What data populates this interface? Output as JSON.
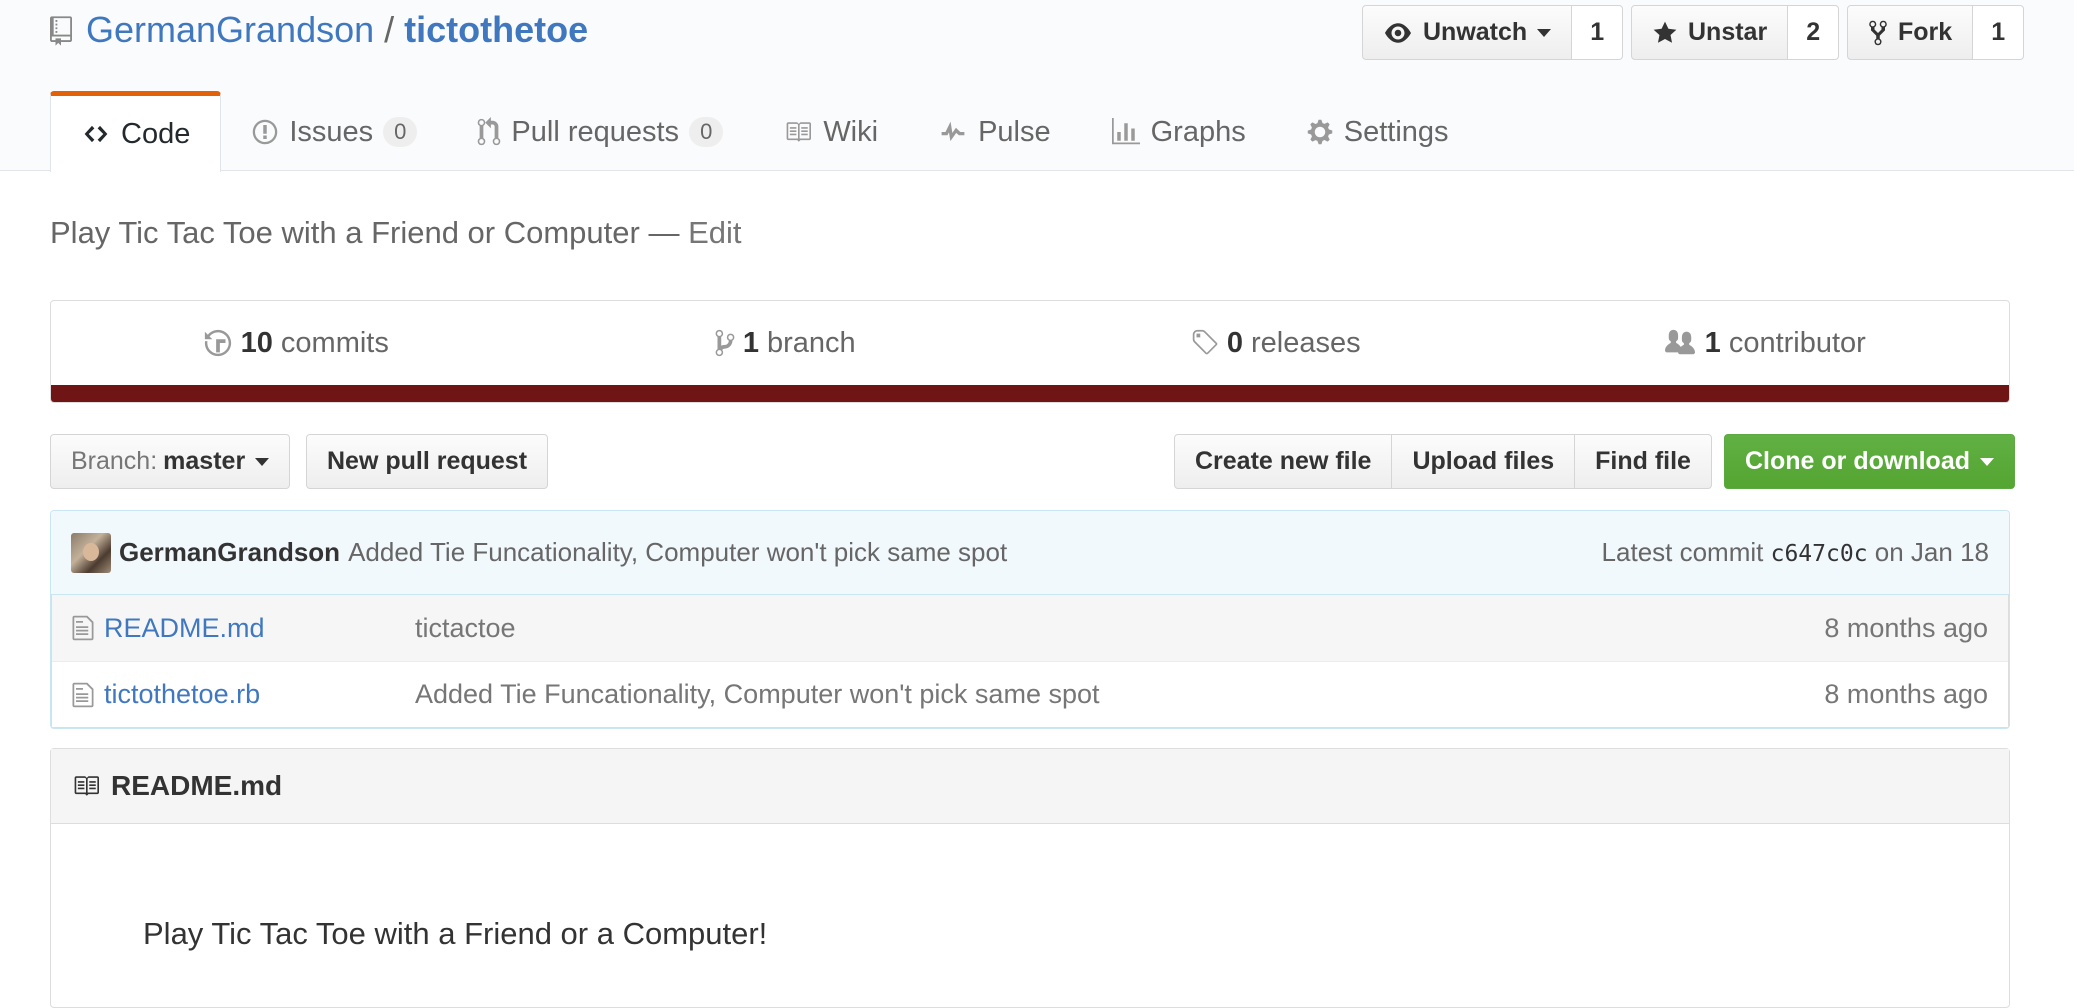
{
  "repo": {
    "owner": "GermanGrandson",
    "separator": "/",
    "name": "tictothetoe"
  },
  "actions": {
    "watch_label": "Unwatch",
    "watch_count": "1",
    "star_label": "Unstar",
    "star_count": "2",
    "fork_label": "Fork",
    "fork_count": "1"
  },
  "tabs": [
    {
      "label": "Code",
      "icon": "code-icon",
      "selected": true
    },
    {
      "label": "Issues",
      "icon": "issue-icon",
      "count": "0"
    },
    {
      "label": "Pull requests",
      "icon": "pull-request-icon",
      "count": "0"
    },
    {
      "label": "Wiki",
      "icon": "book-icon"
    },
    {
      "label": "Pulse",
      "icon": "pulse-icon"
    },
    {
      "label": "Graphs",
      "icon": "graph-icon"
    },
    {
      "label": "Settings",
      "icon": "gear-icon"
    }
  ],
  "description": {
    "text": "Play Tic Tac Toe with a Friend or Computer",
    "dash": " — ",
    "edit_label": "Edit"
  },
  "summary": {
    "commits_num": "10",
    "commits_label": "commits",
    "branches_num": "1",
    "branches_label": "branch",
    "releases_num": "0",
    "releases_label": "releases",
    "contributors_num": "1",
    "contributors_label": "contributor",
    "language_color": "#701516"
  },
  "file_nav": {
    "branch_prefix": "Branch:",
    "branch_name": "master",
    "new_pr_label": "New pull request",
    "create_file_label": "Create new file",
    "upload_label": "Upload files",
    "find_label": "Find file",
    "clone_label": "Clone or download"
  },
  "commit_tease": {
    "author": "GermanGrandson",
    "message": "Added Tie Funcationality, Computer won't pick same spot",
    "latest_label": "Latest commit",
    "sha": "c647c0c",
    "date": "on Jan 18"
  },
  "files": [
    {
      "name": "README.md",
      "message": "tictactoe",
      "age": "8 months ago"
    },
    {
      "name": "tictothetoe.rb",
      "message": "Added Tie Funcationality, Computer won't pick same spot",
      "age": "8 months ago"
    }
  ],
  "readme": {
    "title": "README.md",
    "body": "Play Tic Tac Toe with a Friend or a Computer!"
  },
  "colors": {
    "link": "#4078c0",
    "accent_tab": "#e36209",
    "clone_green": "#55a532"
  }
}
